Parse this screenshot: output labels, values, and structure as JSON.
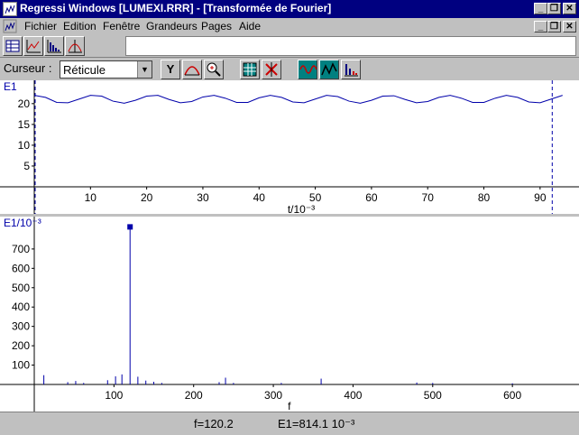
{
  "window": {
    "title": "Regressi Windows [LUMEXI.RRR] - [Transformée de Fourier]",
    "buttons": [
      "_",
      "❐",
      "✕"
    ]
  },
  "menu": {
    "items": [
      {
        "label": "Fichier"
      },
      {
        "label": "Edition"
      },
      {
        "label": "Fenêtre"
      },
      {
        "label": "Grandeurs"
      },
      {
        "label": "Pages"
      },
      {
        "label": "Aide"
      }
    ],
    "mdi_buttons": [
      "_",
      "❐",
      "✕"
    ]
  },
  "toolbar": {
    "cursor_label": "Curseur :",
    "cursor_mode": "Réticule",
    "y_button": "Y"
  },
  "chart_data": [
    {
      "type": "line",
      "ylabel": "E1",
      "xlabel": "t/10⁻³",
      "xlim": [
        0,
        95
      ],
      "ylim": [
        0,
        23
      ],
      "xticks": [
        10,
        20,
        30,
        40,
        50,
        60,
        70,
        80,
        90
      ],
      "yticks": [
        5,
        10,
        15,
        20
      ],
      "series": [
        {
          "values_desc": "oscillating around 21 with amplitude ~1, period ~8.3",
          "x": [
            0,
            2,
            4,
            6,
            8,
            10,
            12,
            14,
            16,
            18,
            20,
            22,
            24,
            26,
            28,
            30,
            32,
            34,
            36,
            38,
            40,
            42,
            44,
            46,
            48,
            50,
            52,
            54,
            56,
            58,
            60,
            62,
            64,
            66,
            68,
            70,
            72,
            74,
            76,
            78,
            80,
            82,
            84,
            86,
            88,
            90,
            92,
            94
          ],
          "y": [
            22,
            21.5,
            20.3,
            20.2,
            21.1,
            22,
            21.8,
            20.6,
            20.1,
            20.8,
            21.8,
            22,
            21,
            20.2,
            20.5,
            21.6,
            22,
            21.3,
            20.3,
            20.3,
            21.4,
            22,
            21.5,
            20.4,
            20.2,
            21.1,
            22,
            21.7,
            20.6,
            20.1,
            20.8,
            21.8,
            21.9,
            21,
            20.2,
            20.5,
            21.5,
            22,
            21.3,
            20.3,
            20.3,
            21.3,
            22,
            21.5,
            20.4,
            20.2,
            21.1,
            22
          ]
        }
      ],
      "cursor_lines_x": [
        0,
        92
      ],
      "color": "#0000aa"
    },
    {
      "type": "bar",
      "ylabel": "E1/10⁻³",
      "xlabel": "f",
      "xlim": [
        0,
        670
      ],
      "ylim": [
        0,
        830
      ],
      "xticks": [
        100,
        200,
        300,
        400,
        500,
        600
      ],
      "yticks": [
        100,
        200,
        300,
        400,
        500,
        600,
        700
      ],
      "x": [
        12,
        42,
        52,
        62,
        92,
        102,
        110,
        120.2,
        130,
        140,
        150,
        160,
        232,
        240,
        250,
        310,
        360,
        480,
        500,
        600
      ],
      "values": [
        48,
        12,
        18,
        8,
        22,
        42,
        52,
        814.1,
        40,
        20,
        14,
        8,
        12,
        35,
        8,
        8,
        30,
        10,
        8,
        6
      ],
      "highlight_x": 120.2,
      "color": "#0000aa"
    }
  ],
  "status": {
    "freq": "f=120.2",
    "value": "E1=814.1 10⁻³"
  }
}
